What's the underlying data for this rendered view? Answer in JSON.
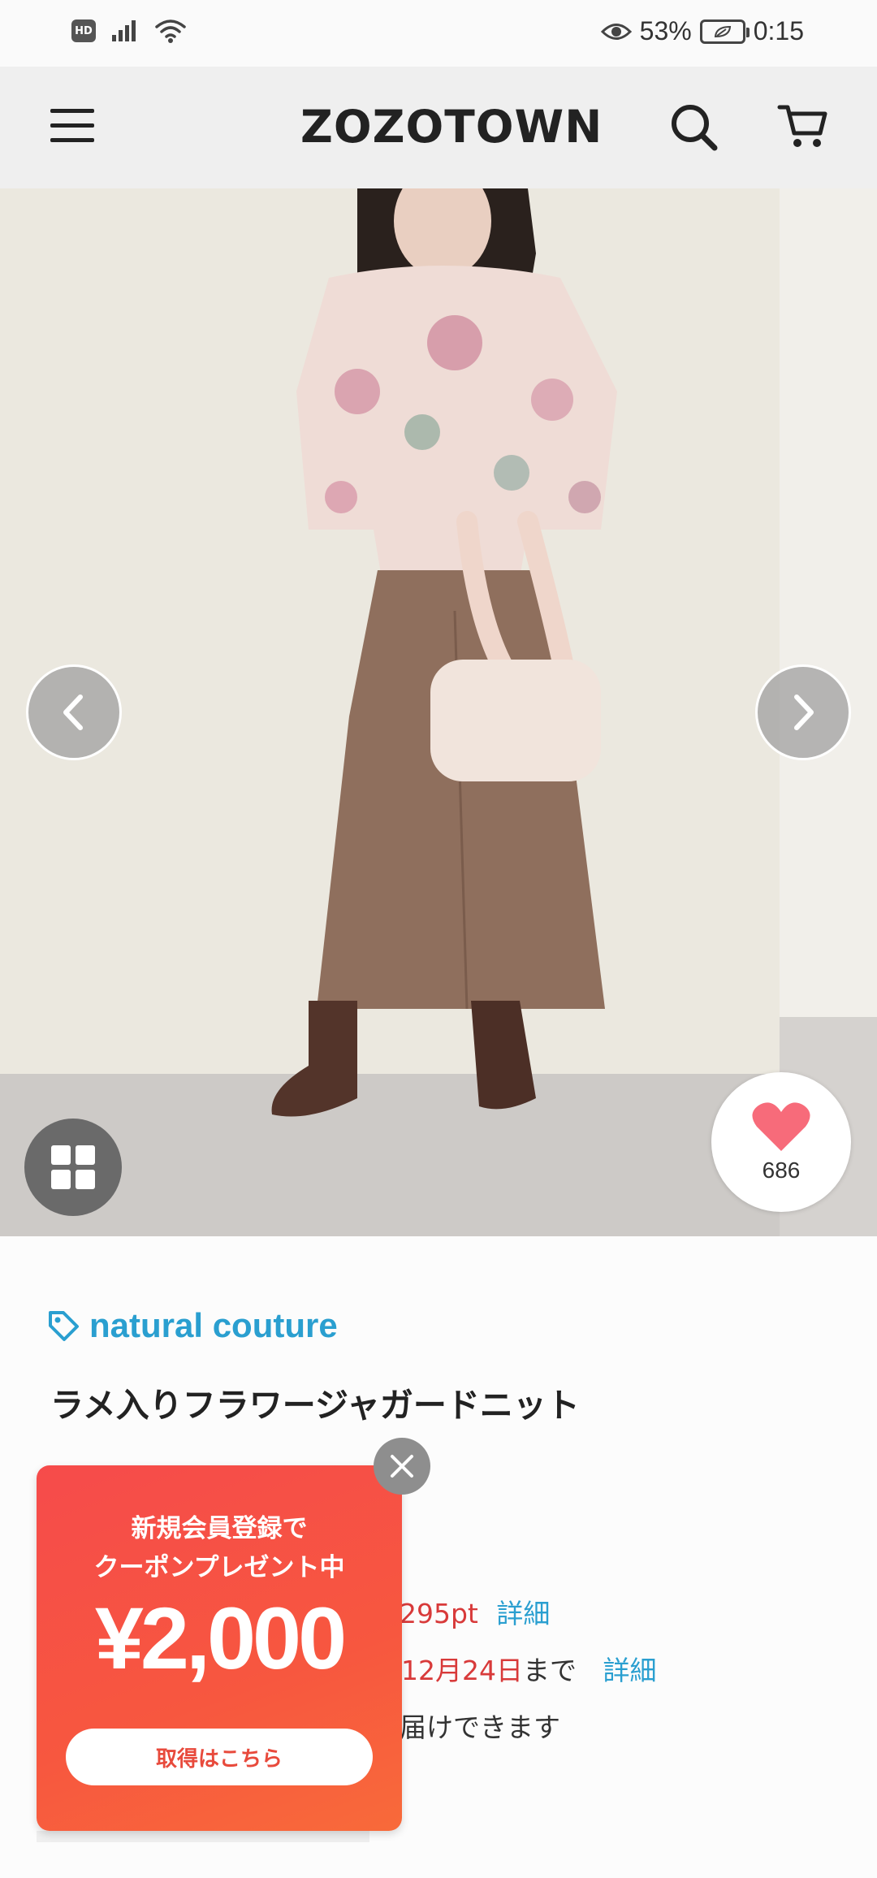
{
  "status_bar": {
    "hd_label": "HD",
    "battery_percent": "53%",
    "time": "0:15"
  },
  "header": {
    "logo": "ZOZOTOWN",
    "menu_icon": "hamburger-menu-icon",
    "search_icon": "search-icon",
    "cart_icon": "cart-icon"
  },
  "gallery": {
    "favorite_count": "686",
    "prev_icon": "chevron-left-icon",
    "next_icon": "chevron-right-icon",
    "grid_icon": "grid-icon"
  },
  "product": {
    "brand": "natural couture",
    "title": "ラメ入りフラワージャガードニット",
    "points_text": "295pt",
    "points_detail": "詳細",
    "coupon_date": "12月24日",
    "coupon_suffix": "まで",
    "coupon_detail": "詳細",
    "delivery_text": "届けできます"
  },
  "promo": {
    "line1": "新規会員登録で",
    "line2": "クーポンプレゼント中",
    "amount": "¥2,000",
    "cta": "取得はこちら"
  },
  "colors": {
    "brand_blue": "#2a9fd0",
    "sale_red": "#d83a3a",
    "promo_red": "#f64b4b",
    "heart_pink": "#f76b7a"
  }
}
